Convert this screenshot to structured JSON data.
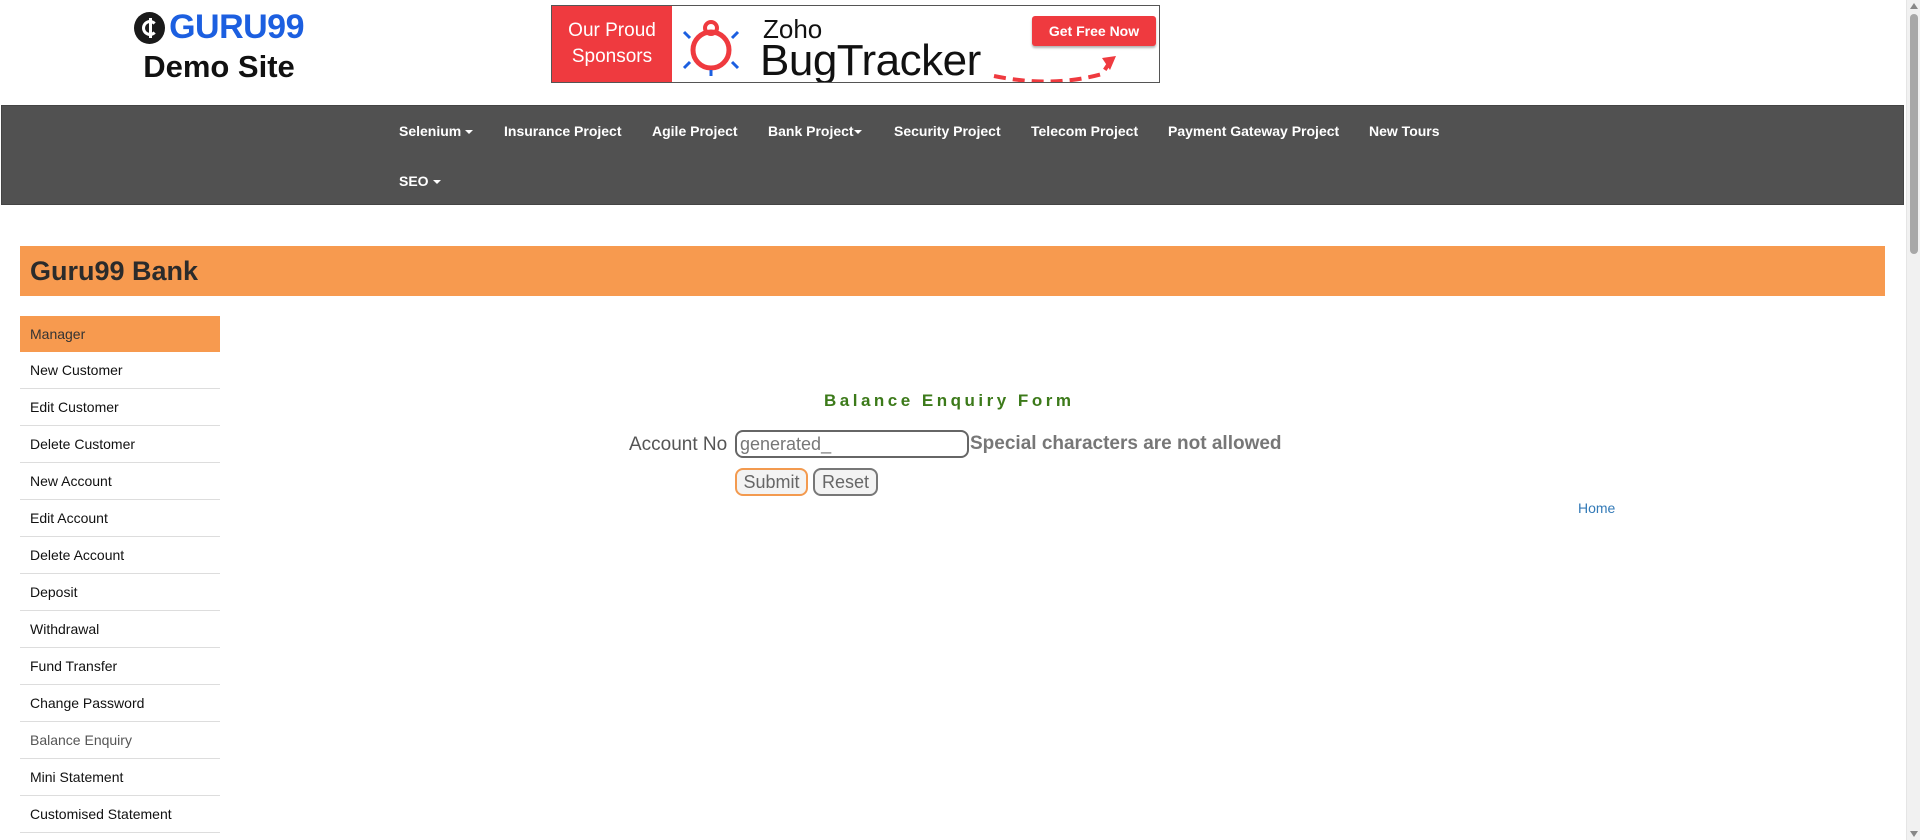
{
  "header": {
    "logo_text": "GURU99",
    "site_label": "Demo Site"
  },
  "banner": {
    "sponsor_line1": "Our Proud",
    "sponsor_line2": "Sponsors",
    "brand_small": "Zoho",
    "brand_large": "BugTracker",
    "cta_label": "Get Free Now",
    "accent_color": "#ef3a3f"
  },
  "nav": {
    "items": [
      {
        "label": "Selenium",
        "dropdown": true
      },
      {
        "label": "Insurance Project",
        "dropdown": false
      },
      {
        "label": "Agile Project",
        "dropdown": false
      },
      {
        "label": "Bank Project",
        "dropdown": true
      },
      {
        "label": "Security Project",
        "dropdown": false
      },
      {
        "label": "Telecom Project",
        "dropdown": false
      },
      {
        "label": "Payment Gateway Project",
        "dropdown": false
      },
      {
        "label": "New Tours",
        "dropdown": false
      },
      {
        "label": "SEO",
        "dropdown": true
      }
    ],
    "background": "#515151"
  },
  "bank_header": {
    "title": "Guru99 Bank",
    "color": "#f79a4f"
  },
  "sidebar": {
    "items": [
      {
        "label": "Manager"
      },
      {
        "label": "New Customer"
      },
      {
        "label": "Edit Customer"
      },
      {
        "label": "Delete Customer"
      },
      {
        "label": "New Account"
      },
      {
        "label": "Edit Account"
      },
      {
        "label": "Delete Account"
      },
      {
        "label": "Deposit"
      },
      {
        "label": "Withdrawal"
      },
      {
        "label": "Fund Transfer"
      },
      {
        "label": "Change Password"
      },
      {
        "label": "Balance Enquiry"
      },
      {
        "label": "Mini Statement"
      },
      {
        "label": "Customised Statement"
      }
    ]
  },
  "form": {
    "title": "Balance Enquiry Form",
    "account_label": "Account No",
    "account_value": "generated_",
    "error_message": "Special characters are not allowed",
    "submit_label": "Submit",
    "reset_label": "Reset",
    "home_link": "Home"
  }
}
